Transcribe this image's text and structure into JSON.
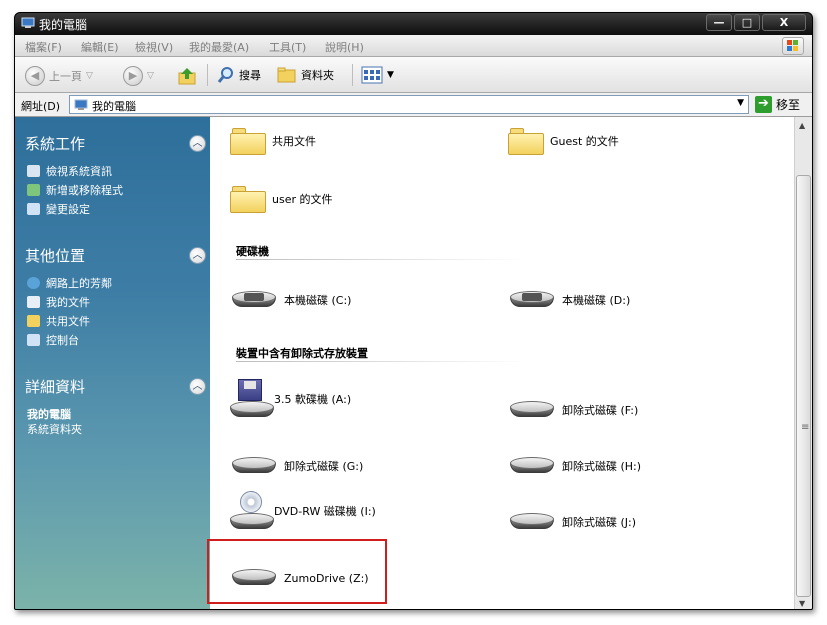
{
  "window": {
    "title": "我的電腦",
    "min_label": "—",
    "max_label": "□",
    "close_label": "X"
  },
  "menu": {
    "items": [
      "檔案(F)",
      "編輯(E)",
      "檢視(V)",
      "我的最愛(A)",
      "工具(T)",
      "說明(H)"
    ]
  },
  "toolbar": {
    "back_label": "上一頁",
    "search_label": "搜尋",
    "folders_label": "資料夾"
  },
  "address": {
    "label": "網址(D)",
    "value": "我的電腦",
    "go_label": "移至"
  },
  "left_pane": {
    "system_tasks": {
      "title": "系統工作",
      "links": [
        "檢視系統資訊",
        "新增或移除程式",
        "變更設定"
      ]
    },
    "other_places": {
      "title": "其他位置",
      "links": [
        "網路上的芳鄰",
        "我的文件",
        "共用文件",
        "控制台"
      ]
    },
    "details": {
      "title": "詳細資料",
      "name": "我的電腦",
      "desc": "系統資料夾"
    }
  },
  "content": {
    "folders": [
      "共用文件",
      "Guest 的文件",
      "user 的文件"
    ],
    "hdd_header": "硬碟機",
    "hdds": [
      "本機磁碟 (C:)",
      "本機磁碟 (D:)"
    ],
    "removable_header": "裝置中含有卸除式存放裝置",
    "removables": [
      "3.5 軟碟機 (A:)",
      "卸除式磁碟 (F:)",
      "卸除式磁碟 (G:)",
      "卸除式磁碟 (H:)",
      "DVD-RW 磁碟機 (I:)",
      "卸除式磁碟 (J:)",
      "ZumoDrive (Z:)"
    ]
  },
  "colors": {
    "highlight": "#d21d1d",
    "left_pane_top": "#2e6f9b",
    "left_pane_bottom": "#7cb3a9"
  }
}
